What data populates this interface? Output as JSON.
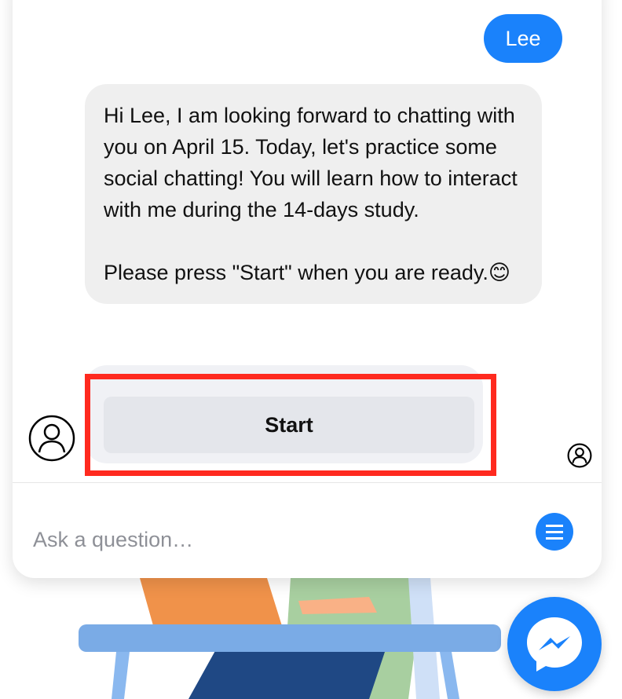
{
  "chat": {
    "user_message": "Lee",
    "bot_message": "Hi Lee, I am looking forward to chatting with you on April 15. Today, let's practice some social chatting! You will learn how to interact with me during the 14-days study.\n\nPlease press \"Start\" when you are ready.😊",
    "quick_reply": "Start"
  },
  "composer": {
    "placeholder": "Ask a question…",
    "menu_icon": "hamburger-menu-icon"
  },
  "launcher": {
    "icon": "messenger-icon"
  },
  "colors": {
    "accent": "#1a82fb",
    "highlight": "#ff2a1f",
    "bubble": "#efefef"
  }
}
